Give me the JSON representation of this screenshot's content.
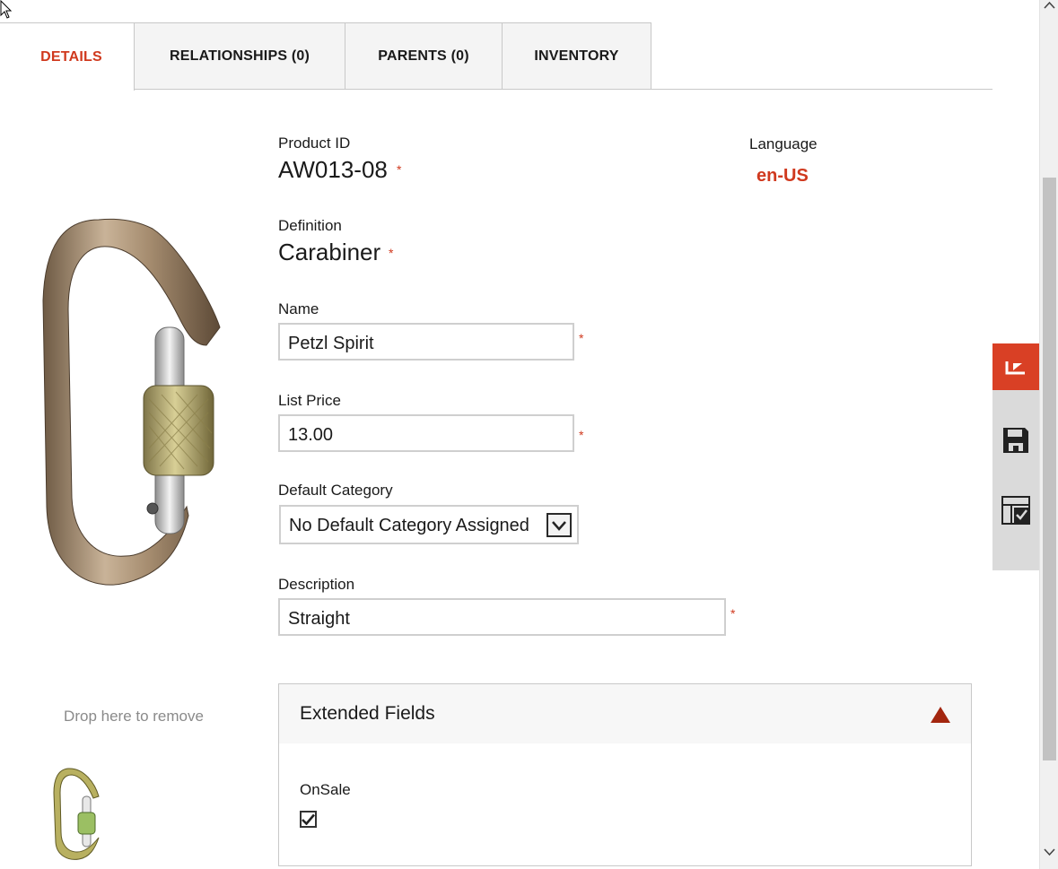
{
  "tabs": [
    {
      "label": "DETAILS",
      "active": true
    },
    {
      "label": "RELATIONSHIPS (0)",
      "active": false
    },
    {
      "label": "PARENTS (0)",
      "active": false
    },
    {
      "label": "INVENTORY",
      "active": false
    }
  ],
  "product_id": {
    "label": "Product ID",
    "value": "AW013-08",
    "required_mark": "*"
  },
  "language": {
    "label": "Language",
    "value": "en-US"
  },
  "definition": {
    "label": "Definition",
    "value": "Carabiner",
    "required_mark": "*"
  },
  "name": {
    "label": "Name",
    "value": "Petzl Spirit",
    "required_mark": "*"
  },
  "list_price": {
    "label": "List Price",
    "value": "13.00",
    "required_mark": "*"
  },
  "default_category": {
    "label": "Default Category",
    "selected": "No Default Category Assigned"
  },
  "description": {
    "label": "Description",
    "value": "Straight",
    "required_mark": "*"
  },
  "images": {
    "drop_text": "Drop here to remove"
  },
  "extended_fields": {
    "title": "Extended Fields",
    "expanded": true,
    "onsale": {
      "label": "OnSale",
      "checked": true
    }
  },
  "colors": {
    "accent": "#d0391e",
    "action_primary": "#d94025",
    "action_bar": "#dadada"
  },
  "action_bar": {
    "icons": [
      "collapse-icon",
      "save-icon",
      "layout-check-icon"
    ]
  }
}
